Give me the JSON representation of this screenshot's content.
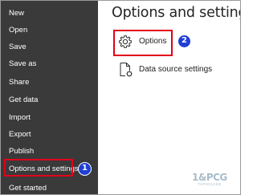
{
  "sidebar": {
    "items": [
      {
        "label": "New"
      },
      {
        "label": "Open"
      },
      {
        "label": "Save"
      },
      {
        "label": "Save as"
      },
      {
        "label": "Share"
      },
      {
        "label": "Get data"
      },
      {
        "label": "Import"
      },
      {
        "label": "Export"
      },
      {
        "label": "Publish"
      },
      {
        "label": "Options and settings"
      },
      {
        "label": "Get started"
      }
    ],
    "callout": "1"
  },
  "main": {
    "title": "Options and settings",
    "options": {
      "label": "Options",
      "icon": "gear-icon"
    },
    "data_source": {
      "label": "Data source settings",
      "icon": "data-source-settings-icon"
    },
    "callout": "2"
  },
  "watermark": {
    "logo": "1&PCG",
    "tagline": "TAPSGUIDE"
  },
  "colors": {
    "sidebar_bg": "#3a3a3a",
    "highlight": "#e2001a",
    "callout": "#1f3fd6"
  }
}
